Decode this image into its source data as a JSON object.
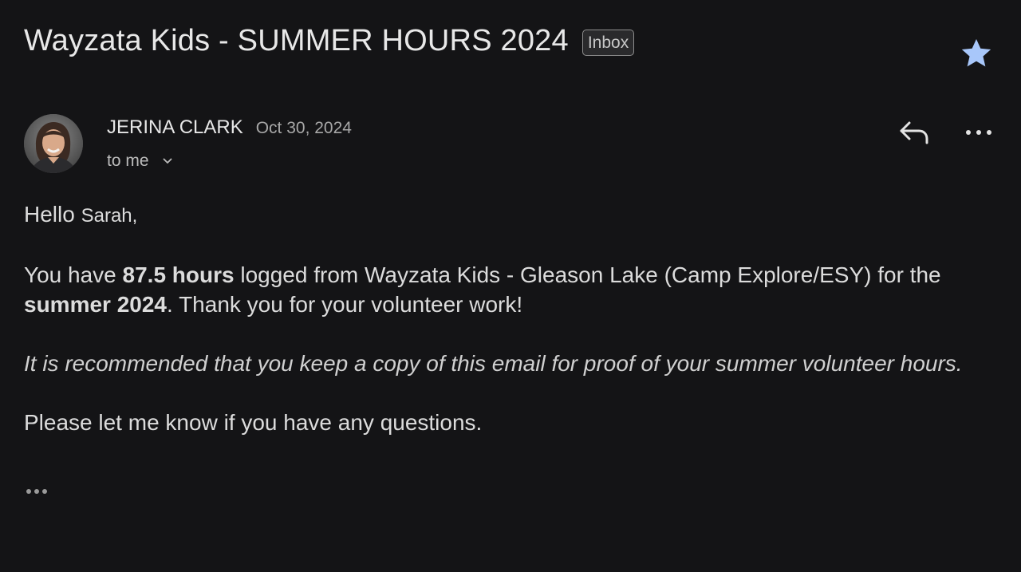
{
  "email": {
    "subject": "Wayzata Kids - SUMMER HOURS 2024",
    "label": "Inbox",
    "starred": true,
    "sender_name": "JERINA CLARK",
    "date": "Oct 30, 2024",
    "to_label": "to me",
    "body": {
      "greeting_hello": "Hello",
      "greeting_name": "Sarah,",
      "p1_a": "You have ",
      "p1_hours": "87.5 hours",
      "p1_b": " logged from Wayzata Kids - Gleason Lake (Camp Explore/ESY) for the ",
      "p1_season": "summer 2024",
      "p1_c": ". Thank you for your volunteer work!",
      "p2": "It is recommended that you keep a copy of this email for proof of your summer volunteer hours.",
      "p3": "Please let me know if you have any questions."
    }
  },
  "colors": {
    "background": "#141416",
    "star": "#a8c7fa",
    "text": "#dcdcdc"
  },
  "icons": {
    "star": "star-icon",
    "reply": "reply-icon",
    "more": "more-vert-icon",
    "chevron": "chevron-down-icon",
    "trimmed": "ellipsis-icon"
  }
}
